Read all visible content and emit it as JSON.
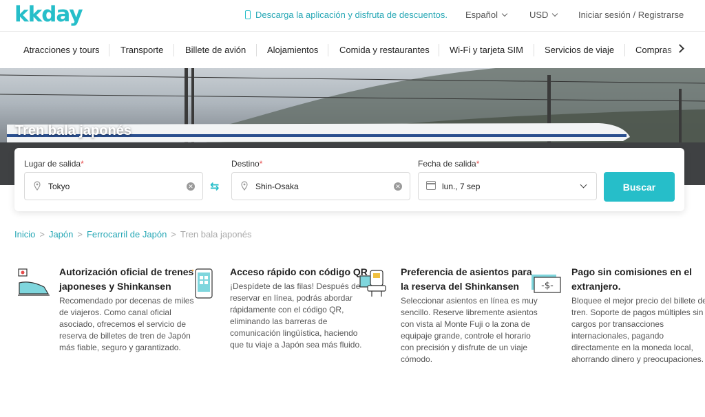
{
  "header": {
    "logo": "kkday",
    "promo": "Descarga la aplicación y disfruta de descuentos.",
    "language": "Español",
    "currency": "USD",
    "login": "Iniciar sesión / Registrarse"
  },
  "nav": {
    "items": [
      {
        "label": "Atracciones y tours"
      },
      {
        "label": "Transporte"
      },
      {
        "label": "Billete de avión"
      },
      {
        "label": "Alojamientos"
      },
      {
        "label": "Comida y restaurantes"
      },
      {
        "label": "Wi-Fi y tarjeta SIM"
      },
      {
        "label": "Servicios de viaje"
      },
      {
        "label": "Compras"
      }
    ]
  },
  "hero": {
    "title": "Tren bala japonés"
  },
  "search": {
    "origin_label": "Lugar de salida",
    "origin_value": "Tokyo",
    "destination_label": "Destino",
    "destination_value": "Shin-Osaka",
    "date_label": "Fecha de salida",
    "date_value": "lun., 7 sep",
    "required_mark": "*",
    "button": "Buscar"
  },
  "breadcrumb": {
    "items": [
      "Inicio",
      "Japón",
      "Ferrocarril de Japón"
    ],
    "current": "Tren bala japonés",
    "separator": ">"
  },
  "features": [
    {
      "icon": "train-ticket-icon",
      "title": "Autorización oficial de trenes japoneses y Shinkansen",
      "text": "Recomendado por decenas de miles de viajeros. Como canal oficial asociado, ofrecemos el servicio de reserva de billetes de tren de Japón más fiable, seguro y garantizado."
    },
    {
      "icon": "qr-phone-icon",
      "title": "Acceso rápido con código QR",
      "text": "¡Despídete de las filas! Después de reservar en línea, podrás abordar rápidamente con el código QR, eliminando las barreras de comunicación lingüística, haciendo que tu viaje a Japón sea más fluido."
    },
    {
      "icon": "seat-icon",
      "title": "Preferencia de asientos para la reserva del Shinkansen",
      "text": "Seleccionar asientos en línea es muy sencillo. Reserve libremente asientos con vista al Monte Fuji o la zona de equipaje grande, controle el horario con precisión y disfrute de un viaje cómodo."
    },
    {
      "icon": "money-bill-icon",
      "title": "Pago sin comisiones en el extranjero.",
      "text": "Bloquee el mejor precio del billete de tren. Soporte de pagos múltiples sin cargos por transacciones internacionales, pagando directamente en la moneda local, ahorrando dinero y preocupaciones."
    }
  ],
  "colors": {
    "brand": "#26bec9",
    "link": "#26a7b5",
    "required": "#e54b4b"
  }
}
